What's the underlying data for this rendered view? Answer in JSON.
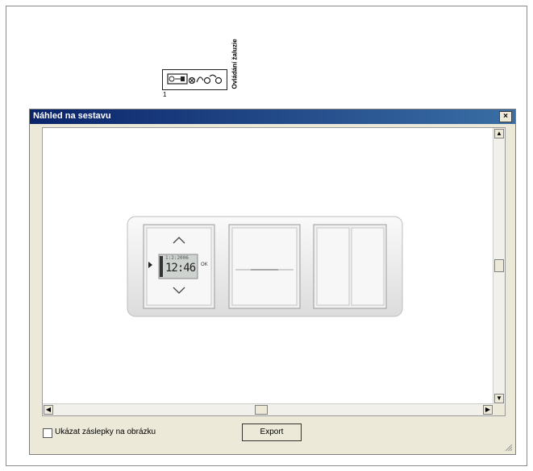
{
  "schematic": {
    "label": "Ovládání žaluzie",
    "number": "1"
  },
  "dialog": {
    "title": "Náhled na sestavu",
    "close_glyph": "×",
    "device": {
      "display_small": "1:2:2006",
      "display_time": "12:46",
      "ok_label": "OK"
    },
    "checkbox_label": "Ukázat záslepky na obrázku",
    "checkbox_checked": false,
    "export_label": "Export"
  }
}
